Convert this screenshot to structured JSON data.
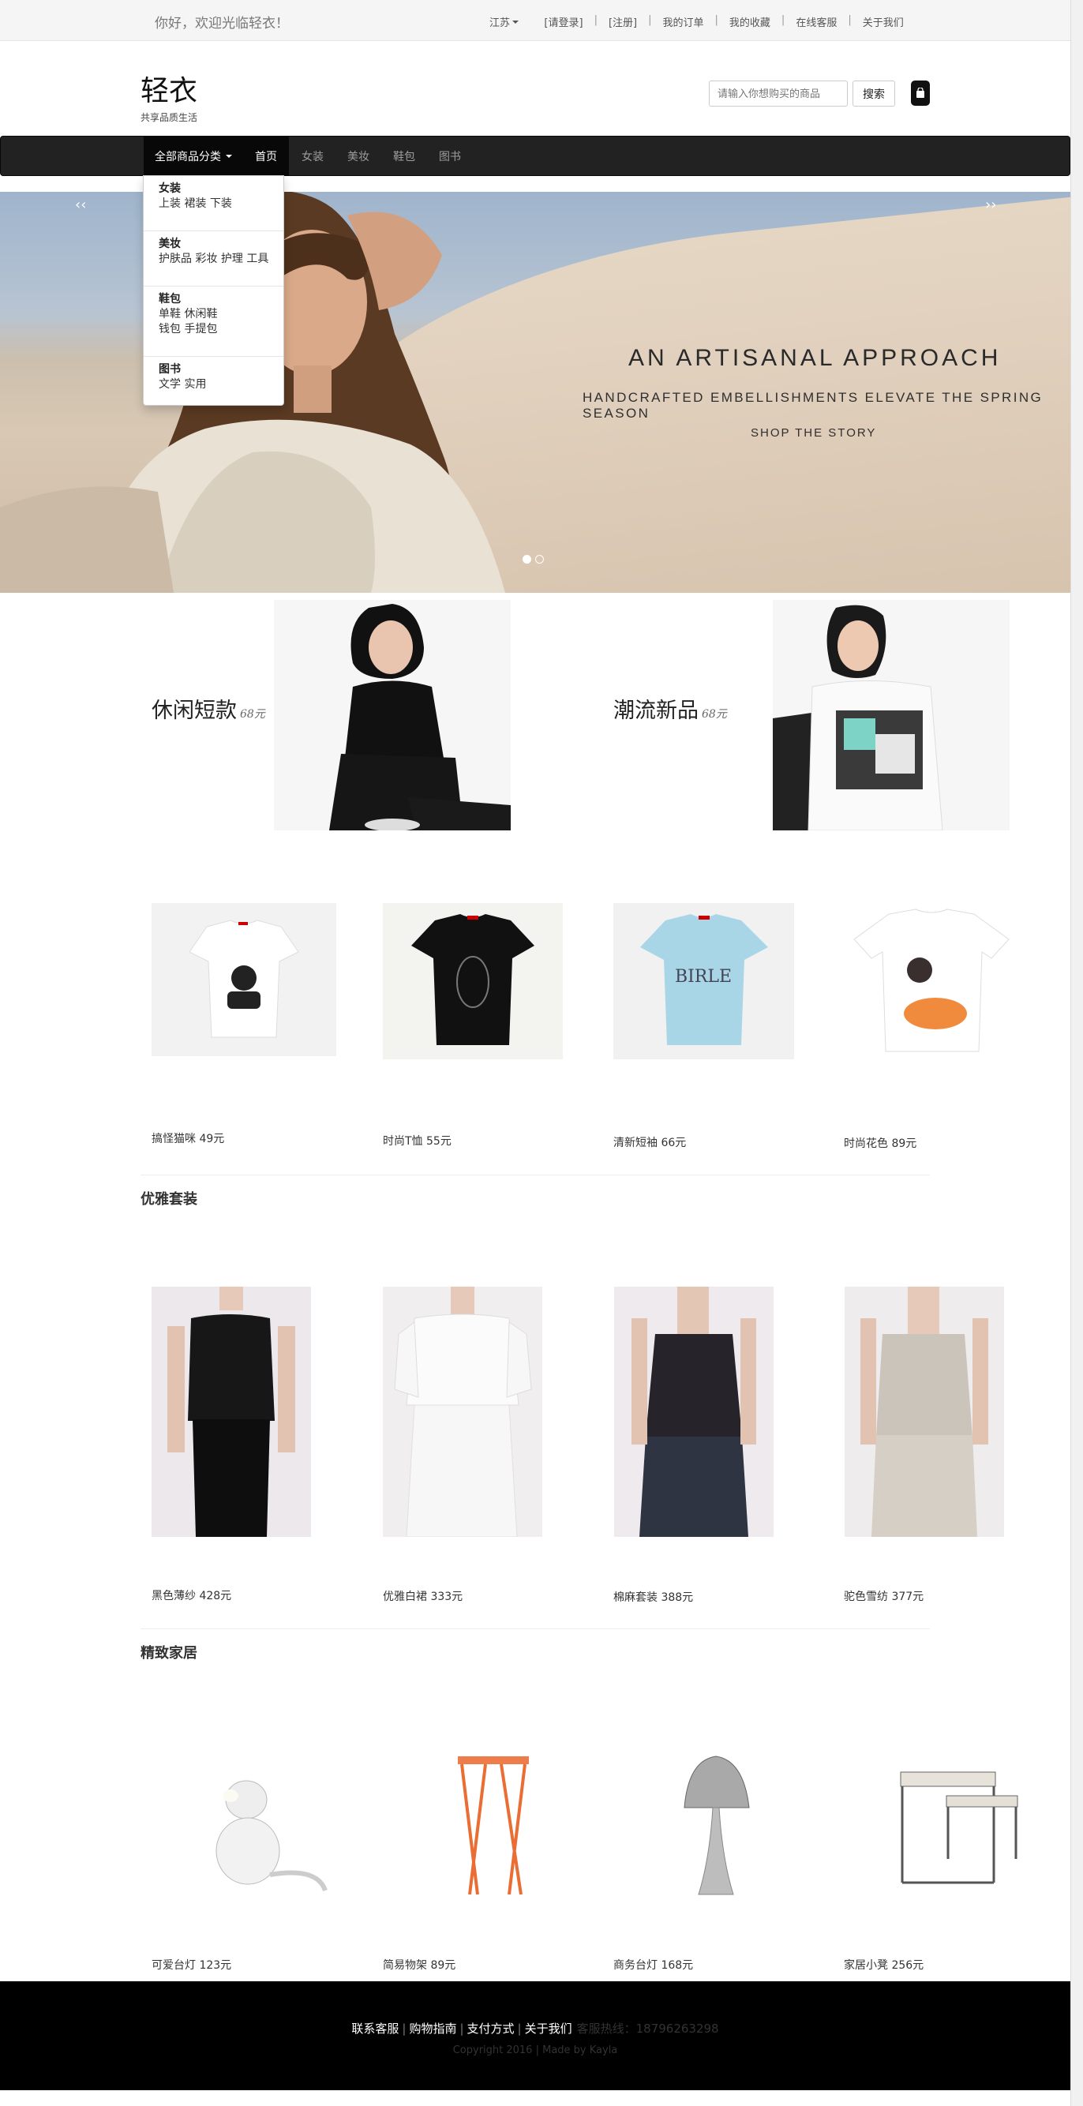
{
  "topbar": {
    "welcome": "你好，欢迎光临轻衣！",
    "links": [
      "江苏",
      "[请登录]",
      "[注册]",
      "我的订单",
      "我的收藏",
      "在线客服",
      "关于我们"
    ]
  },
  "header": {
    "brand": "轻衣",
    "tagline": "共享品质生活",
    "search_placeholder": "请输入你想购买的商品",
    "search_button": "搜索"
  },
  "nav": {
    "category": "全部商品分类",
    "links": [
      "首页",
      "女装",
      "美妆",
      "鞋包",
      "图书"
    ]
  },
  "dropdown": [
    {
      "title": "女装",
      "lines": [
        "上装 裙装 下装"
      ]
    },
    {
      "title": "美妆",
      "lines": [
        "护肤品 彩妆 护理 工具"
      ]
    },
    {
      "title": "鞋包",
      "lines": [
        "单鞋 休闲鞋",
        "钱包 手提包"
      ]
    },
    {
      "title": "图书",
      "lines": [
        "文学 实用"
      ]
    }
  ],
  "hero": {
    "title": "AN ARTISANAL APPROACH",
    "subtitle": "HANDCRAFTED EMBELLISHMENTS ELEVATE THE SPRING SEASON",
    "cta": "SHOP THE STORY",
    "prev": "‹‹",
    "next": "››"
  },
  "features": [
    {
      "name": "休闲短款",
      "price": "68元"
    },
    {
      "name": "潮流新品",
      "price": "68元"
    }
  ],
  "tees": [
    {
      "label": "搞怪猫咪 49元"
    },
    {
      "label": "时尚T恤 55元"
    },
    {
      "label": "清新短袖 66元"
    },
    {
      "label": "时尚花色 89元"
    }
  ],
  "suits_section": {
    "title": "优雅套装",
    "items": [
      {
        "label": "黑色薄纱 428元"
      },
      {
        "label": "优雅白裙 333元"
      },
      {
        "label": "棉麻套装 388元"
      },
      {
        "label": "驼色雪纺 377元"
      }
    ]
  },
  "home_section": {
    "title": "精致家居",
    "items": [
      {
        "label": "可爱台灯 123元"
      },
      {
        "label": "简易物架 89元"
      },
      {
        "label": "商务台灯 168元"
      },
      {
        "label": "家居小凳 256元"
      }
    ]
  },
  "footer": {
    "links": [
      "联系客服",
      "购物指南",
      "支付方式",
      "关于我们"
    ],
    "hotline": "客服热线：18796263298",
    "copyright": "Copyright 2016 | Made by Kayla"
  },
  "colors": {
    "navbar": "#222222",
    "footer": "#000000",
    "accent": "#080808"
  }
}
